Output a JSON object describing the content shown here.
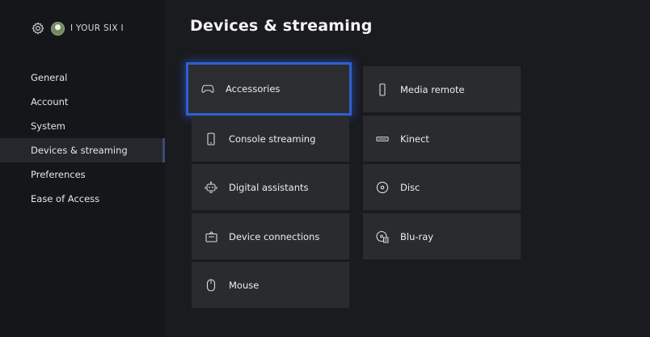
{
  "header": {
    "gamertag": "I YOUR SIX I",
    "title": "Devices & streaming",
    "settings_icon": "gear-icon",
    "avatar_icon": "avatar"
  },
  "sidebar": {
    "items": [
      {
        "label": "General"
      },
      {
        "label": "Account"
      },
      {
        "label": "System"
      },
      {
        "label": "Devices & streaming",
        "selected": true
      },
      {
        "label": "Preferences"
      },
      {
        "label": "Ease of Access"
      }
    ]
  },
  "tiles": {
    "left": [
      {
        "label": "Accessories",
        "icon": "controller-icon",
        "focused": true
      },
      {
        "label": "Console streaming",
        "icon": "phone-icon"
      },
      {
        "label": "Digital assistants",
        "icon": "assistant-icon"
      },
      {
        "label": "Device connections",
        "icon": "connection-icon"
      },
      {
        "label": "Mouse",
        "icon": "mouse-icon"
      }
    ],
    "right": [
      {
        "label": "Media remote",
        "icon": "remote-icon"
      },
      {
        "label": "Kinect",
        "icon": "kinect-icon"
      },
      {
        "label": "Disc",
        "icon": "disc-icon"
      },
      {
        "label": "Blu-ray",
        "icon": "bluray-icon"
      }
    ]
  },
  "colors": {
    "focus_border": "#2f5fd0",
    "tile_background": "#2a2b2f",
    "sidebar_background": "#15161a",
    "selected_indicator": "#3a4b74"
  }
}
